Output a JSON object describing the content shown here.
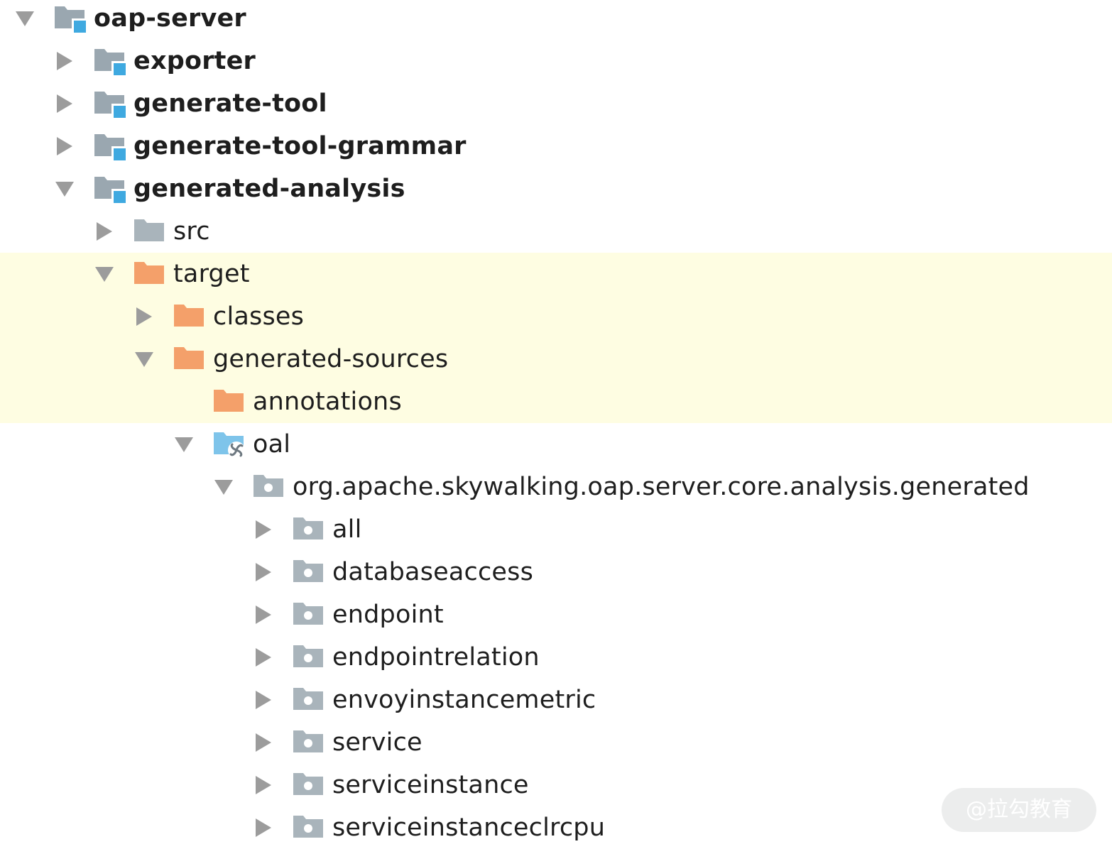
{
  "colors": {
    "highlight": "#fefde2",
    "arrow": "#9c9c9c",
    "module_folder": "#9aa7b0",
    "module_badge": "#3fa9e0",
    "plain_folder": "#a9b4bb",
    "excluded_folder": "#f4a06a",
    "generated_folder": "#7ec4ea",
    "package_folder": "#a9b4bb"
  },
  "tree": [
    {
      "label": "oap-server",
      "depth": 0,
      "expanded": true,
      "icon": "module-folder-icon",
      "bold": true,
      "highlighted": false,
      "has_arrow": true
    },
    {
      "label": "exporter",
      "depth": 1,
      "expanded": false,
      "icon": "module-folder-icon",
      "bold": true,
      "highlighted": false,
      "has_arrow": true
    },
    {
      "label": "generate-tool",
      "depth": 1,
      "expanded": false,
      "icon": "module-folder-icon",
      "bold": true,
      "highlighted": false,
      "has_arrow": true
    },
    {
      "label": "generate-tool-grammar",
      "depth": 1,
      "expanded": false,
      "icon": "module-folder-icon",
      "bold": true,
      "highlighted": false,
      "has_arrow": true
    },
    {
      "label": "generated-analysis",
      "depth": 1,
      "expanded": true,
      "icon": "module-folder-icon",
      "bold": true,
      "highlighted": false,
      "has_arrow": true
    },
    {
      "label": "src",
      "depth": 2,
      "expanded": false,
      "icon": "folder-icon",
      "bold": false,
      "highlighted": false,
      "has_arrow": true
    },
    {
      "label": "target",
      "depth": 2,
      "expanded": true,
      "icon": "excluded-folder-icon",
      "bold": false,
      "highlighted": true,
      "has_arrow": true
    },
    {
      "label": "classes",
      "depth": 3,
      "expanded": false,
      "icon": "excluded-folder-icon",
      "bold": false,
      "highlighted": true,
      "has_arrow": true
    },
    {
      "label": "generated-sources",
      "depth": 3,
      "expanded": true,
      "icon": "excluded-folder-icon",
      "bold": false,
      "highlighted": true,
      "has_arrow": true
    },
    {
      "label": "annotations",
      "depth": 4,
      "expanded": false,
      "icon": "excluded-folder-icon",
      "bold": false,
      "highlighted": true,
      "has_arrow": false
    },
    {
      "label": "oal",
      "depth": 4,
      "expanded": true,
      "icon": "generated-sources-folder-icon",
      "bold": false,
      "highlighted": false,
      "has_arrow": true
    },
    {
      "label": "org.apache.skywalking.oap.server.core.analysis.generated",
      "depth": 5,
      "expanded": true,
      "icon": "package-icon",
      "bold": false,
      "highlighted": false,
      "has_arrow": true
    },
    {
      "label": "all",
      "depth": 6,
      "expanded": false,
      "icon": "package-icon",
      "bold": false,
      "highlighted": false,
      "has_arrow": true
    },
    {
      "label": "databaseaccess",
      "depth": 6,
      "expanded": false,
      "icon": "package-icon",
      "bold": false,
      "highlighted": false,
      "has_arrow": true
    },
    {
      "label": "endpoint",
      "depth": 6,
      "expanded": false,
      "icon": "package-icon",
      "bold": false,
      "highlighted": false,
      "has_arrow": true
    },
    {
      "label": "endpointrelation",
      "depth": 6,
      "expanded": false,
      "icon": "package-icon",
      "bold": false,
      "highlighted": false,
      "has_arrow": true
    },
    {
      "label": "envoyinstancemetric",
      "depth": 6,
      "expanded": false,
      "icon": "package-icon",
      "bold": false,
      "highlighted": false,
      "has_arrow": true
    },
    {
      "label": "service",
      "depth": 6,
      "expanded": false,
      "icon": "package-icon",
      "bold": false,
      "highlighted": false,
      "has_arrow": true
    },
    {
      "label": "serviceinstance",
      "depth": 6,
      "expanded": false,
      "icon": "package-icon",
      "bold": false,
      "highlighted": false,
      "has_arrow": true
    },
    {
      "label": "serviceinstanceclrcpu",
      "depth": 6,
      "expanded": false,
      "icon": "package-icon",
      "bold": false,
      "highlighted": false,
      "has_arrow": true
    }
  ],
  "watermark": {
    "text": "@拉勾教育"
  }
}
